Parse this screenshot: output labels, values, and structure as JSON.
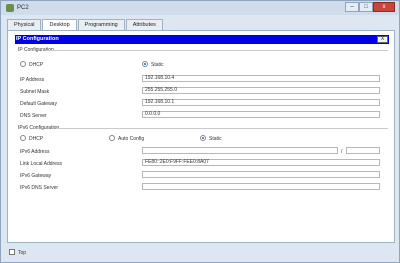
{
  "window": {
    "title": "PC2",
    "minimize": "–",
    "maximize": "□",
    "close": "x"
  },
  "tabs": [
    {
      "label": "Physical"
    },
    {
      "label": "Desktop"
    },
    {
      "label": "Programming"
    },
    {
      "label": "Attributes"
    }
  ],
  "active_tab": "Desktop",
  "ip_config": {
    "header": "IP Configuration",
    "close_label": "X",
    "ipv4_section": "IP Configuration",
    "dhcp_label": "DHCP",
    "static_label": "Static",
    "mode": "Static",
    "fields": [
      {
        "label": "IP Address",
        "value": "192.168.10.4"
      },
      {
        "label": "Subnet Mask",
        "value": "255.255.255.0"
      },
      {
        "label": "Default Gateway",
        "value": "192.168.10.1"
      },
      {
        "label": "DNS Server",
        "value": "0.0.0.0"
      }
    ],
    "ipv6_section": "IPv6 Configuration",
    "ipv6_dhcp_label": "DHCP",
    "ipv6_auto_label": "Auto Config",
    "ipv6_static_label": "Static",
    "ipv6_mode": "Static",
    "ipv6_address_label": "IPv6 Address",
    "ipv6_address_value": "",
    "prefix_separator": "/",
    "prefix_value": "",
    "link_local_label": "Link Local Address",
    "link_local_value": "FE80::2E0:F9FF:FEE0:8A07",
    "ipv6_gateway_label": "IPv6 Gateway",
    "ipv6_gateway_value": "",
    "ipv6_dns_label": "IPv6 DNS Server",
    "ipv6_dns_value": ""
  },
  "footer": {
    "top_label": "Top",
    "top_checked": false
  }
}
